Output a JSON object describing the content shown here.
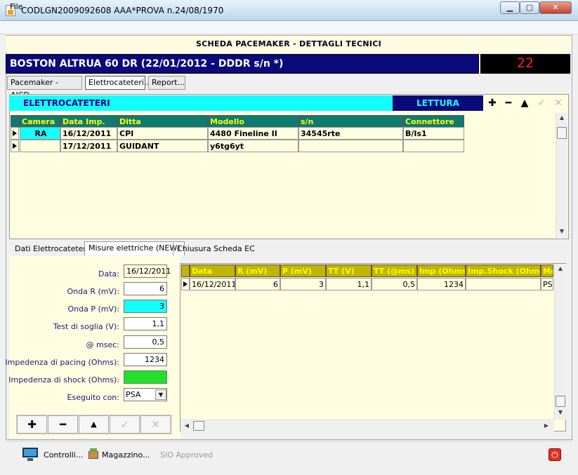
{
  "window": {
    "title": "CODLGN2009092608 AAA*PROVA n.24/08/1970"
  },
  "menu": {
    "file": "File"
  },
  "header": {
    "scheda_title": "SCHEDA PACEMAKER - DETTAGLI TECNICI",
    "device": "BOSTON ALTRUA 60 DR (22/01/2012 - DDDR s/n *)",
    "counter": "22"
  },
  "tabs": [
    {
      "label": "Pacemaker - AICD..."
    },
    {
      "label": "Elettrocateteri..."
    },
    {
      "label": "Report..."
    }
  ],
  "elettro": {
    "title": "ELETTROCATETERI",
    "lettura": "LETTURA ARCHIVIO",
    "columns": [
      "Camera",
      "Data Imp.",
      "Ditta",
      "Modello",
      "s/n",
      "Connettore"
    ],
    "rows": [
      [
        "RA",
        "16/12/2011",
        "CPI",
        "4480 Fineline II",
        "34545rte",
        "B/Is1"
      ],
      [
        "",
        "17/12/2011",
        "GUIDANT",
        "y6tg6yt",
        "",
        ""
      ]
    ]
  },
  "subtabs": [
    {
      "label": "Dati Elettrocatetere"
    },
    {
      "label": "Misure elettriche (NEW)"
    },
    {
      "label": "Chiusura Scheda EC"
    }
  ],
  "form": {
    "data_label": "Data:",
    "data_value": "16/12/2011",
    "onda_r_label": "Onda R (mV):",
    "onda_r_value": "6",
    "onda_p_label": "Onda P (mV):",
    "onda_p_value": "3",
    "soglia_label": "Test di soglia (V):",
    "soglia_value": "1,1",
    "msec_label": "@ msec:",
    "msec_value": "0,5",
    "imp_pacing_label": "Impedenza di pacing (Ohms):",
    "imp_pacing_value": "1234",
    "imp_shock_label": "Impedenza di shock (Ohms):",
    "imp_shock_value": "",
    "eseguito_label": "Eseguito con:",
    "eseguito_value": "PSA"
  },
  "misure": {
    "columns": [
      "Data",
      "R (mV)",
      "P (mV)",
      "TT (V)",
      "TT (@ms)",
      "Imp (Ohms)",
      "Imp.Shock (Ohms)",
      "Me"
    ],
    "rows": [
      [
        "16/12/2011",
        "6",
        "3",
        "1,1",
        "0,5",
        "1234",
        "",
        "PS."
      ]
    ]
  },
  "status": {
    "controlli": "Controlli...",
    "magazzino": "Magazzino...",
    "sio": "SIO Approved"
  },
  "colors": {
    "header_bg": "#0a0a7a",
    "cyan": "#14ffff",
    "grid_head": "#0f7a70",
    "panel": "#fffde0",
    "shock_field": "#22e02a"
  }
}
